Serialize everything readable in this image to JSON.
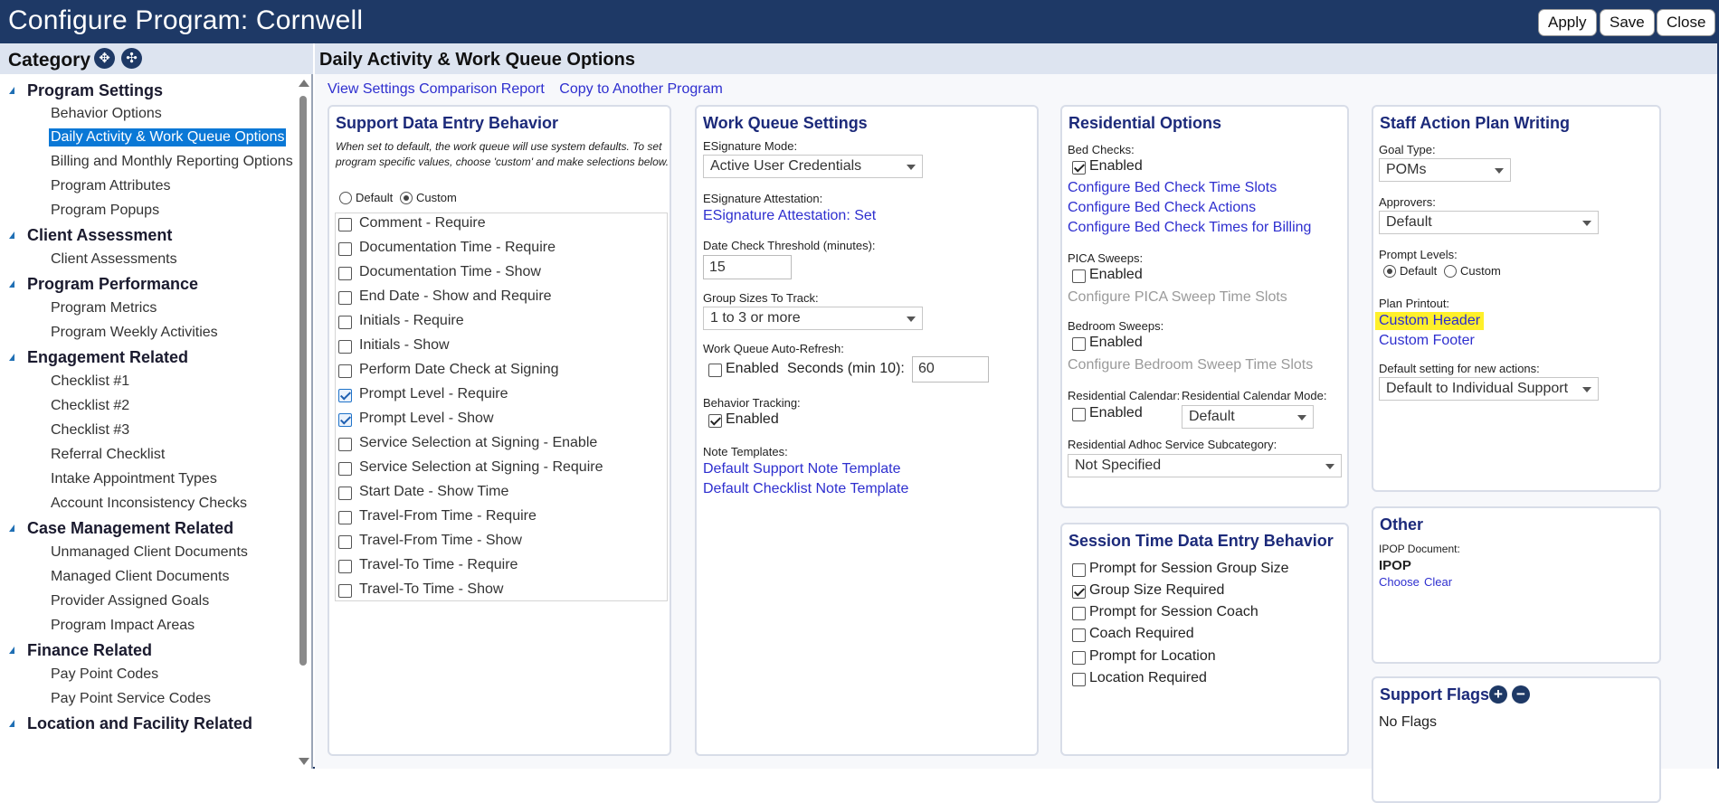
{
  "window": {
    "title": "Configure Program: Cornwell",
    "buttons": {
      "apply": "Apply",
      "save": "Save",
      "close": "Close"
    }
  },
  "sidebar": {
    "header": "Category",
    "groups": [
      {
        "label": "Program Settings",
        "items": [
          "Behavior Options",
          "Daily Activity & Work Queue Options",
          "Billing and Monthly Reporting Options",
          "Program Attributes",
          "Program Popups"
        ]
      },
      {
        "label": "Client Assessment",
        "items": [
          "Client Assessments"
        ]
      },
      {
        "label": "Program Performance",
        "items": [
          "Program Metrics",
          "Program Weekly Activities"
        ]
      },
      {
        "label": "Engagement Related",
        "items": [
          "Checklist #1",
          "Checklist #2",
          "Checklist #3",
          "Referral Checklist",
          "Intake Appointment Types",
          "Account Inconsistency Checks"
        ]
      },
      {
        "label": "Case Management Related",
        "items": [
          "Unmanaged Client Documents",
          "Managed Client Documents",
          "Provider Assigned Goals",
          "Program Impact Areas"
        ]
      },
      {
        "label": "Finance Related",
        "items": [
          "Pay Point Codes",
          "Pay Point Service Codes"
        ]
      },
      {
        "label": "Location and Facility Related",
        "items": []
      }
    ],
    "selected": "Daily Activity & Work Queue Options"
  },
  "main": {
    "title": "Daily Activity & Work Queue Options",
    "links": [
      "View Settings Comparison Report",
      "Copy to Another Program"
    ]
  },
  "support_data": {
    "title": "Support Data Entry Behavior",
    "description": "When set to default, the work queue will use system defaults. To set program specific values, choose 'custom' and make selections below.",
    "radio_default": "Default",
    "radio_custom": "Custom",
    "checkboxes": [
      {
        "label": "Comment - Require",
        "checked": false
      },
      {
        "label": "Documentation Time - Require",
        "checked": false
      },
      {
        "label": "Documentation Time - Show",
        "checked": false
      },
      {
        "label": "End Date - Show and Require",
        "checked": false
      },
      {
        "label": "Initials - Require",
        "checked": false
      },
      {
        "label": "Initials - Show",
        "checked": false
      },
      {
        "label": "Perform Date Check at Signing",
        "checked": false
      },
      {
        "label": "Prompt Level - Require",
        "checked": true
      },
      {
        "label": "Prompt Level - Show",
        "checked": true
      },
      {
        "label": "Service Selection at Signing - Enable",
        "checked": false
      },
      {
        "label": "Service Selection at Signing - Require",
        "checked": false
      },
      {
        "label": "Start Date - Show Time",
        "checked": false
      },
      {
        "label": "Travel-From Time - Require",
        "checked": false
      },
      {
        "label": "Travel-From Time - Show",
        "checked": false
      },
      {
        "label": "Travel-To Time - Require",
        "checked": false
      },
      {
        "label": "Travel-To Time - Show",
        "checked": false
      }
    ]
  },
  "work_queue": {
    "title": "Work Queue Settings",
    "esig_mode_label": "ESignature Mode:",
    "esig_mode_value": "Active User Credentials",
    "esig_attest_label": "ESignature Attestation:",
    "esig_attest_link": "ESignature Attestation: Set",
    "date_check_label": "Date Check Threshold (minutes):",
    "date_check_value": "15",
    "group_sizes_label": "Group Sizes To Track:",
    "group_sizes_value": "1 to 3 or more",
    "auto_refresh_label": "Work Queue Auto-Refresh:",
    "auto_refresh_enabled": "Enabled",
    "seconds_label": "Seconds (min 10):",
    "seconds_value": "60",
    "behavior_label": "Behavior Tracking:",
    "behavior_enabled": "Enabled",
    "note_templates_label": "Note Templates:",
    "note_support_link": "Default Support Note Template",
    "note_checklist_link": "Default Checklist Note Template"
  },
  "residential": {
    "title": "Residential Options",
    "bed_checks_label": "Bed Checks:",
    "bed_enabled": "Enabled",
    "bed_links": [
      "Configure Bed Check Time Slots",
      "Configure Bed Check Actions",
      "Configure Bed Check Times for Billing"
    ],
    "pica_label": "PICA Sweeps:",
    "pica_enabled": "Enabled",
    "pica_link": "Configure PICA Sweep Time Slots",
    "bedroom_label": "Bedroom Sweeps:",
    "bedroom_enabled": "Enabled",
    "bedroom_link": "Configure Bedroom Sweep Time Slots",
    "calendar_label": "Residential Calendar:",
    "calendar_enabled": "Enabled",
    "calendar_mode_label": "Residential Calendar Mode:",
    "calendar_mode_value": "Default",
    "adhoc_label": "Residential Adhoc Service Subcategory:",
    "adhoc_value": "Not Specified"
  },
  "session_time": {
    "title": "Session Time Data Entry Behavior",
    "checkboxes": [
      {
        "label": "Prompt for Session Group Size",
        "checked": false
      },
      {
        "label": "Group Size Required",
        "checked": true
      },
      {
        "label": "Prompt for Session Coach",
        "checked": false
      },
      {
        "label": "Coach Required",
        "checked": false
      },
      {
        "label": "Prompt for Location",
        "checked": false
      },
      {
        "label": "Location Required",
        "checked": false
      }
    ]
  },
  "staff_action": {
    "title": "Staff Action Plan Writing",
    "goal_type_label": "Goal Type:",
    "goal_type_value": "POMs",
    "approvers_label": "Approvers:",
    "approvers_value": "Default",
    "prompt_levels_label": "Prompt Levels:",
    "prompt_default": "Default",
    "prompt_custom": "Custom",
    "plan_printout_label": "Plan Printout:",
    "custom_header": "Custom Header",
    "custom_footer": "Custom Footer",
    "default_setting_label": "Default setting for new actions:",
    "default_setting_value": "Default to Individual Support"
  },
  "other": {
    "title": "Other",
    "ipop_label": "IPOP Document:",
    "ipop_value": "IPOP",
    "choose": "Choose",
    "clear": "Clear"
  },
  "support_flags": {
    "title": "Support Flags",
    "empty": "No Flags"
  },
  "colors": {
    "titlebar": "#1e3966",
    "card_title": "#1c2a7a",
    "link": "#2e2fcf",
    "selected": "#0a78d6",
    "highlight": "#fff02a"
  }
}
